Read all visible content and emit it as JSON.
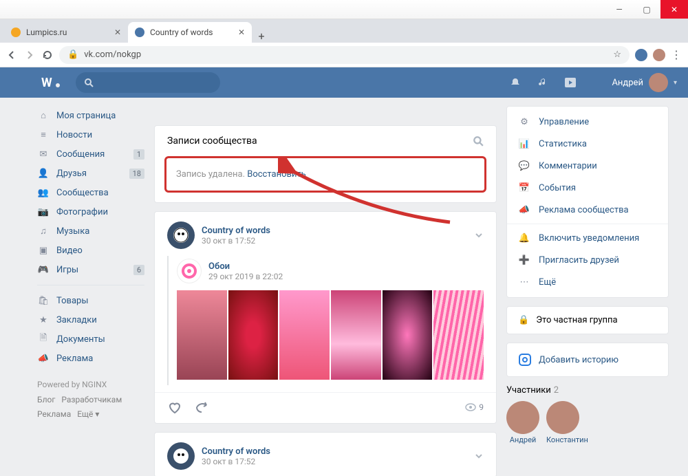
{
  "window": {
    "min": "—",
    "max": "▢",
    "close": "✕"
  },
  "tabs": {
    "t0": {
      "title": "Lumpics.ru"
    },
    "t1": {
      "title": "Country of words"
    },
    "plus": "+"
  },
  "url": {
    "lock": "🔒",
    "text": "vk.com/nokgp",
    "star": "☆",
    "dots": "⋮"
  },
  "vkheader": {
    "user": "Андрей",
    "chev": "▾"
  },
  "leftnav": {
    "items": [
      {
        "icon": "⌂",
        "label": "Моя страница"
      },
      {
        "icon": "≡",
        "label": "Новости"
      },
      {
        "icon": "✉",
        "label": "Сообщения",
        "badge": "1"
      },
      {
        "icon": "👤",
        "label": "Друзья",
        "badge": "18"
      },
      {
        "icon": "👥",
        "label": "Сообщества"
      },
      {
        "icon": "📷",
        "label": "Фотографии"
      },
      {
        "icon": "♫",
        "label": "Музыка"
      },
      {
        "icon": "▣",
        "label": "Видео"
      },
      {
        "icon": "🎮",
        "label": "Игры",
        "badge": "6"
      }
    ],
    "items2": [
      {
        "icon": "🛍",
        "label": "Товары"
      },
      {
        "icon": "★",
        "label": "Закладки"
      },
      {
        "icon": "🗎",
        "label": "Документы"
      },
      {
        "icon": "📣",
        "label": "Реклама"
      }
    ],
    "powered": "Powered by NGINX",
    "f1": "Блог",
    "f2": "Разработчикам",
    "f3": "Реклама",
    "f4": "Ещё ▾"
  },
  "wall": {
    "title": "Записи сообщества",
    "deleted": {
      "text": "Запись удалена. ",
      "restore": "Восстановить"
    },
    "post1": {
      "name": "Country of words",
      "date": "30 окт в 17:52",
      "repost_name": "Обои",
      "repost_date": "29 окт 2019 в 22:02",
      "views": "9"
    },
    "post2": {
      "name": "Country of words",
      "date": "30 окт в 17:52"
    }
  },
  "rightmenu": {
    "a": [
      {
        "icon": "⚙",
        "label": "Управление"
      },
      {
        "icon": "📊",
        "label": "Статистика"
      },
      {
        "icon": "💬",
        "label": "Комментарии"
      },
      {
        "icon": "📅",
        "label": "События"
      },
      {
        "icon": "📣",
        "label": "Реклама сообщества"
      }
    ],
    "b": [
      {
        "icon": "🔔",
        "label": "Включить уведомления"
      },
      {
        "icon": "➕",
        "label": "Пригласить друзей"
      },
      {
        "icon": "⋯",
        "label": "Ещё"
      }
    ],
    "private": "Это частная группа",
    "story": "Добавить историю",
    "members_label": "Участники",
    "members_count": "2",
    "m1": "Андрей",
    "m2": "Константин"
  }
}
